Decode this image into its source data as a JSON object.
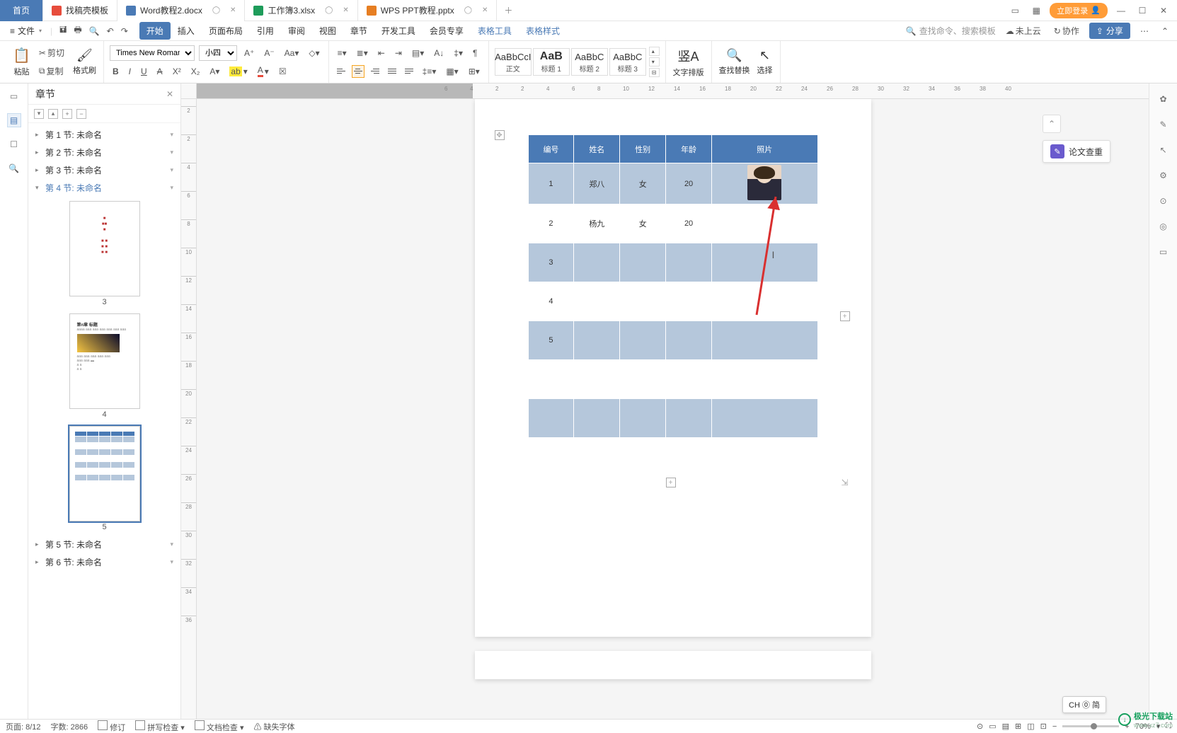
{
  "titlebar": {
    "home": "首页",
    "tabs": [
      {
        "icon_bg": "#e74c3c",
        "label": "找稿壳模板"
      },
      {
        "icon_bg": "#4a7ab5",
        "label": "Word教程2.docx",
        "active": true
      },
      {
        "icon_bg": "#1e9c5a",
        "label": "工作簿3.xlsx"
      },
      {
        "icon_bg": "#e67e22",
        "label": "WPS PPT教程.pptx"
      }
    ],
    "login": "立即登录",
    "icons": {
      "grid": "▦",
      "scan": "⌗",
      "min": "—",
      "max": "☐",
      "close": "✕"
    }
  },
  "menubar": {
    "file_menu": "文件",
    "items": [
      "开始",
      "插入",
      "页面布局",
      "引用",
      "审阅",
      "视图",
      "章节",
      "开发工具",
      "会员专享",
      "表格工具",
      "表格样式"
    ],
    "active_index": 0,
    "blue_from": 9,
    "search_ph": "查找命令、搜索模板",
    "cloud": "未上云",
    "collab": "协作",
    "share": "分享",
    "more": "⋯"
  },
  "ribbon": {
    "paste": "粘贴",
    "cut": "剪切",
    "copy": "复制",
    "format_painter": "格式刷",
    "font_name": "Times New Roman",
    "font_size": "小四",
    "btns": {
      "bold": "B",
      "italic": "I",
      "underline": "U",
      "strike": "S",
      "super": "X²",
      "sub": "X₂",
      "Aplus": "A",
      "Aminus": "A",
      "clear": "◇",
      "phonetic": "变"
    },
    "styles": [
      {
        "prev": "AaBbCcI",
        "name": "正文"
      },
      {
        "prev": "AaB",
        "name": "标题 1",
        "bold": true
      },
      {
        "prev": "AaBbC",
        "name": "标题 2"
      },
      {
        "prev": "AaBbC",
        "name": "标题 3"
      }
    ],
    "text_layout": "文字排版",
    "find_replace": "查找替换",
    "select": "选择"
  },
  "nav": {
    "title": "章节",
    "close": "✕",
    "items": [
      {
        "label": "第 1 节: 未命名"
      },
      {
        "label": "第 2 节: 未命名"
      },
      {
        "label": "第 3 节: 未命名"
      },
      {
        "label": "第 4 节: 未命名",
        "selected": true,
        "expanded": true
      },
      {
        "label": "第 5 节: 未命名"
      },
      {
        "label": "第 6 节: 未命名"
      }
    ],
    "thumb_nums": [
      "3",
      "4",
      "5"
    ]
  },
  "thesis_btn": "论文查重",
  "table": {
    "headers": [
      "编号",
      "姓名",
      "性别",
      "年龄",
      "照片"
    ],
    "rows": [
      {
        "no": "1",
        "name": "郑八",
        "gender": "女",
        "age": "20",
        "photo": true
      },
      {
        "no": "2",
        "name": "杨九",
        "gender": "女",
        "age": "20",
        "photo": false,
        "odd": true
      },
      {
        "no": "3",
        "name": "",
        "gender": "",
        "age": "",
        "photo_empty": true
      },
      {
        "no": "4",
        "name": "",
        "gender": "",
        "age": "",
        "odd": true,
        "photo_empty": true
      },
      {
        "no": "5",
        "name": "",
        "gender": "",
        "age": "",
        "photo_empty": true
      },
      {
        "no": "",
        "name": "",
        "gender": "",
        "age": "",
        "odd": true,
        "photo_empty": true
      },
      {
        "no": "",
        "name": "",
        "gender": "",
        "age": "",
        "photo_empty": true
      },
      {
        "no": "",
        "name": "",
        "gender": "",
        "age": "",
        "odd": true,
        "photo_empty": true
      }
    ]
  },
  "ruler_h": [
    "6",
    "4",
    "2",
    "2",
    "4",
    "6",
    "8",
    "10",
    "12",
    "14",
    "16",
    "18",
    "20",
    "22",
    "24",
    "26",
    "28",
    "30",
    "32",
    "34",
    "36",
    "38",
    "40"
  ],
  "ruler_v": [
    "2",
    "2",
    "4",
    "6",
    "8",
    "10",
    "12",
    "14",
    "16",
    "18",
    "20",
    "22",
    "24",
    "26",
    "28",
    "30",
    "32",
    "34",
    "36"
  ],
  "status": {
    "page": "页面: 8/12",
    "words": "字数: 2866",
    "track": "修订",
    "spell": "拼写检查",
    "doc_check": "文档检查",
    "missing_font": "缺失字体",
    "zoom": "70%",
    "ime": "CH 🄋 简"
  },
  "watermark": {
    "brand": "极光下载站",
    "url": "www.xz7.com"
  }
}
